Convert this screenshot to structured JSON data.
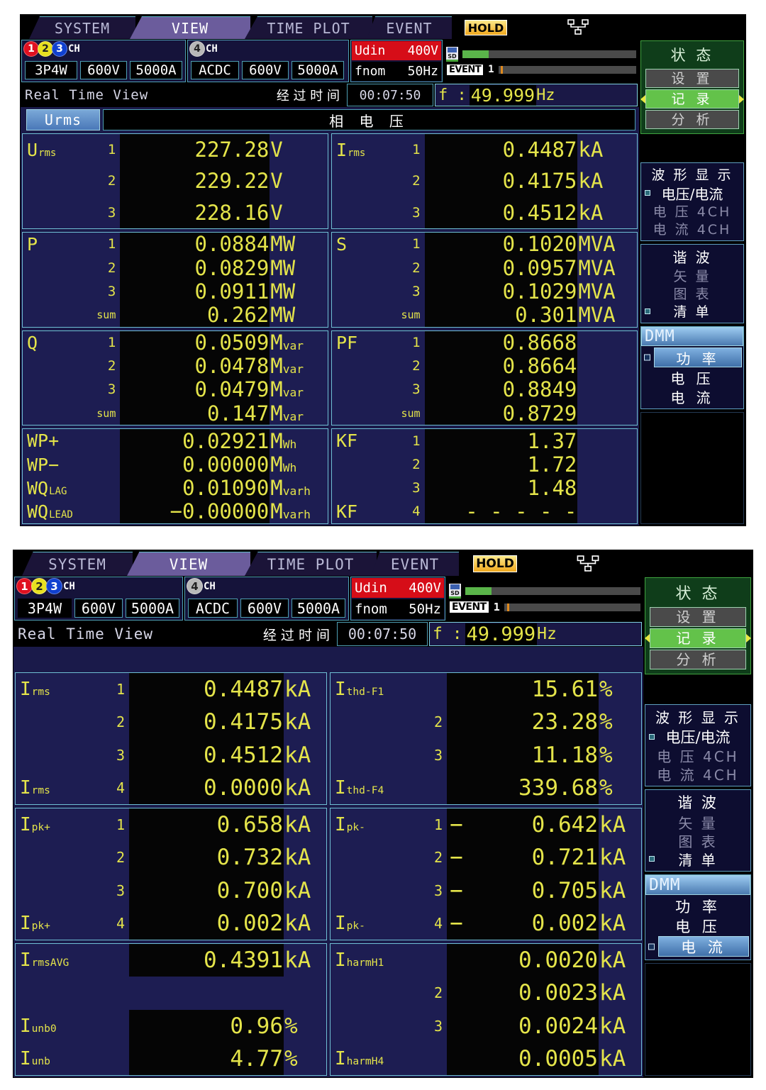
{
  "tabs": [
    {
      "label": "SYSTEM",
      "active": false
    },
    {
      "label": "VIEW",
      "active": true
    },
    {
      "label": "TIME PLOT",
      "active": false
    },
    {
      "label": "EVENT",
      "active": false
    }
  ],
  "hold_badge": "HOLD",
  "network_icon": "network-icon",
  "channel_group_1": {
    "numbers": [
      "1",
      "2",
      "3"
    ],
    "suffix": "CH",
    "fields": [
      "3P4W",
      "600V",
      "5000A"
    ]
  },
  "channel_group_4": {
    "numbers": [
      "4"
    ],
    "suffix": "CH",
    "fields": [
      "ACDC",
      "600V",
      "5000A"
    ]
  },
  "udin": {
    "label": "Udin",
    "value": "400V"
  },
  "fnom": {
    "label": "fnom",
    "value": "50Hz"
  },
  "sd": {
    "icon_label": "SD",
    "fill_percent": 15
  },
  "event": {
    "badge": "EVENT",
    "count": "1",
    "mark_percent": 2
  },
  "status": {
    "realtime_label": "Real Time View",
    "elapsed_label": "经 过 时 间",
    "elapsed_value": "00:07:50",
    "freq_label": "f :",
    "freq_value": "49.999",
    "freq_unit": "Hz"
  },
  "panel_top": {
    "subtab": "Urms",
    "subtitle": "相 电 压",
    "blocks_left": [
      {
        "name": "urms-block",
        "rows": [
          {
            "label": "U",
            "label_sub": "rms",
            "index": "1",
            "value": "227.28",
            "unit": "V",
            "unit_sub": ""
          },
          {
            "label": "",
            "label_sub": "",
            "index": "2",
            "value": "229.22",
            "unit": "V",
            "unit_sub": ""
          },
          {
            "label": "",
            "label_sub": "",
            "index": "3",
            "value": "228.16",
            "unit": "V",
            "unit_sub": ""
          }
        ]
      },
      {
        "name": "active-power-block",
        "rows": [
          {
            "label": "P",
            "label_sub": "",
            "index": "1",
            "value": "0.0884",
            "unit": "MW",
            "unit_sub": ""
          },
          {
            "label": "",
            "label_sub": "",
            "index": "2",
            "value": "0.0829",
            "unit": "MW",
            "unit_sub": ""
          },
          {
            "label": "",
            "label_sub": "",
            "index": "3",
            "value": "0.0911",
            "unit": "MW",
            "unit_sub": ""
          },
          {
            "label": "",
            "label_sub": "",
            "index": "sum",
            "value": "0.262",
            "unit": "MW",
            "unit_sub": ""
          }
        ]
      },
      {
        "name": "reactive-power-block",
        "rows": [
          {
            "label": "Q",
            "label_sub": "",
            "index": "1",
            "value": "0.0509",
            "unit": "M",
            "unit_sub": "var"
          },
          {
            "label": "",
            "label_sub": "",
            "index": "2",
            "value": "0.0478",
            "unit": "M",
            "unit_sub": "var"
          },
          {
            "label": "",
            "label_sub": "",
            "index": "3",
            "value": "0.0479",
            "unit": "M",
            "unit_sub": "var"
          },
          {
            "label": "",
            "label_sub": "",
            "index": "sum",
            "value": "0.147",
            "unit": "M",
            "unit_sub": "var"
          }
        ]
      },
      {
        "name": "energy-block",
        "rows": [
          {
            "label": "WP+",
            "label_sub": "",
            "index": "",
            "value": "0.02921",
            "unit": "M",
            "unit_sub": "Wh"
          },
          {
            "label": "WP−",
            "label_sub": "",
            "index": "",
            "value": "0.00000",
            "unit": "M",
            "unit_sub": "Wh"
          },
          {
            "label": "WQ",
            "label_sub": "LAG",
            "index": "",
            "value": "0.01090",
            "unit": "M",
            "unit_sub": "varh"
          },
          {
            "label": "WQ",
            "label_sub": "LEAD",
            "index": "",
            "value": "−0.00000",
            "unit": "M",
            "unit_sub": "varh"
          }
        ]
      }
    ],
    "blocks_right": [
      {
        "name": "irms-block",
        "rows": [
          {
            "label": "I",
            "label_sub": "rms",
            "index": "1",
            "value": "0.4487",
            "unit": "kA",
            "unit_sub": ""
          },
          {
            "label": "",
            "label_sub": "",
            "index": "2",
            "value": "0.4175",
            "unit": "kA",
            "unit_sub": ""
          },
          {
            "label": "",
            "label_sub": "",
            "index": "3",
            "value": "0.4512",
            "unit": "kA",
            "unit_sub": ""
          }
        ]
      },
      {
        "name": "apparent-power-block",
        "rows": [
          {
            "label": "S",
            "label_sub": "",
            "index": "1",
            "value": "0.1020",
            "unit": "MVA",
            "unit_sub": ""
          },
          {
            "label": "",
            "label_sub": "",
            "index": "2",
            "value": "0.0957",
            "unit": "MVA",
            "unit_sub": ""
          },
          {
            "label": "",
            "label_sub": "",
            "index": "3",
            "value": "0.1029",
            "unit": "MVA",
            "unit_sub": ""
          },
          {
            "label": "",
            "label_sub": "",
            "index": "sum",
            "value": "0.301",
            "unit": "MVA",
            "unit_sub": ""
          }
        ]
      },
      {
        "name": "power-factor-block",
        "rows": [
          {
            "label": "PF",
            "label_sub": "",
            "index": "1",
            "value": "0.8668",
            "unit": "",
            "unit_sub": ""
          },
          {
            "label": "",
            "label_sub": "",
            "index": "2",
            "value": "0.8664",
            "unit": "",
            "unit_sub": ""
          },
          {
            "label": "",
            "label_sub": "",
            "index": "3",
            "value": "0.8849",
            "unit": "",
            "unit_sub": ""
          },
          {
            "label": "",
            "label_sub": "",
            "index": "sum",
            "value": "0.8729",
            "unit": "",
            "unit_sub": ""
          }
        ]
      },
      {
        "name": "k-factor-block",
        "rows": [
          {
            "label": "KF",
            "label_sub": "",
            "index": "1",
            "value": "1.37",
            "unit": "",
            "unit_sub": ""
          },
          {
            "label": "",
            "label_sub": "",
            "index": "2",
            "value": "1.72",
            "unit": "",
            "unit_sub": ""
          },
          {
            "label": "",
            "label_sub": "",
            "index": "3",
            "value": "1.48",
            "unit": "",
            "unit_sub": ""
          },
          {
            "label": "KF",
            "label_sub": "",
            "index": "4",
            "value": "- - - - -",
            "unit": "",
            "unit_sub": ""
          }
        ]
      }
    ]
  },
  "panel_bottom": {
    "blocks_left": [
      {
        "name": "irms-block",
        "rows": [
          {
            "label": "I",
            "label_sub": "rms",
            "index": "1",
            "value": "0.4487",
            "unit": "kA",
            "unit_sub": ""
          },
          {
            "label": "",
            "label_sub": "",
            "index": "2",
            "value": "0.4175",
            "unit": "kA",
            "unit_sub": ""
          },
          {
            "label": "",
            "label_sub": "",
            "index": "3",
            "value": "0.4512",
            "unit": "kA",
            "unit_sub": ""
          },
          {
            "label": "I",
            "label_sub": "rms",
            "index": "4",
            "value": "0.0000",
            "unit": "kA",
            "unit_sub": ""
          }
        ]
      },
      {
        "name": "ipk-plus-block",
        "rows": [
          {
            "label": "I",
            "label_sub": "pk+",
            "index": "1",
            "value": "0.658",
            "unit": "kA",
            "unit_sub": ""
          },
          {
            "label": "",
            "label_sub": "",
            "index": "2",
            "value": "0.732",
            "unit": "kA",
            "unit_sub": ""
          },
          {
            "label": "",
            "label_sub": "",
            "index": "3",
            "value": "0.700",
            "unit": "kA",
            "unit_sub": ""
          },
          {
            "label": "I",
            "label_sub": "pk+",
            "index": "4",
            "value": "0.002",
            "unit": "kA",
            "unit_sub": ""
          }
        ]
      },
      {
        "name": "irms-avg-unbalance-block",
        "rows": [
          {
            "label": "I",
            "label_sub": "rmsAVG",
            "index": "",
            "value": "0.4391",
            "unit": "kA",
            "unit_sub": "",
            "align": "left"
          },
          {
            "label": "",
            "label_sub": "",
            "index": "",
            "value": "",
            "unit": "",
            "unit_sub": "",
            "spacer": true
          },
          {
            "label": "I",
            "label_sub": "unb0",
            "index": "",
            "value": "0.96",
            "unit": "%",
            "unit_sub": ""
          },
          {
            "label": "I",
            "label_sub": "unb",
            "index": "",
            "value": "4.77",
            "unit": "%",
            "unit_sub": ""
          }
        ]
      }
    ],
    "blocks_right": [
      {
        "name": "ithd-f-block",
        "rows": [
          {
            "label": "I",
            "label_sub": "thd-F1",
            "index": "",
            "value": "15.61",
            "unit": "%",
            "unit_sub": ""
          },
          {
            "label": "",
            "label_sub": "",
            "index": "2",
            "value": "23.28",
            "unit": "%",
            "unit_sub": ""
          },
          {
            "label": "",
            "label_sub": "",
            "index": "3",
            "value": "11.18",
            "unit": "%",
            "unit_sub": ""
          },
          {
            "label": "I",
            "label_sub": "thd-F4",
            "index": "",
            "value": "339.68",
            "unit": "%",
            "unit_sub": ""
          }
        ]
      },
      {
        "name": "ipk-minus-block",
        "rows": [
          {
            "label": "I",
            "label_sub": "pk-",
            "index": "1",
            "value": "0.642",
            "unit": "kA",
            "unit_sub": "",
            "neg": "−"
          },
          {
            "label": "",
            "label_sub": "",
            "index": "2",
            "value": "0.721",
            "unit": "kA",
            "unit_sub": "",
            "neg": "−"
          },
          {
            "label": "",
            "label_sub": "",
            "index": "3",
            "value": "0.705",
            "unit": "kA",
            "unit_sub": "",
            "neg": "−"
          },
          {
            "label": "I",
            "label_sub": "pk-",
            "index": "4",
            "value": "0.002",
            "unit": "kA",
            "unit_sub": "",
            "neg": "−"
          }
        ]
      },
      {
        "name": "iharm-block",
        "rows": [
          {
            "label": "I",
            "label_sub": "harmH1",
            "index": "",
            "value": "0.0020",
            "unit": "kA",
            "unit_sub": ""
          },
          {
            "label": "",
            "label_sub": "",
            "index": "2",
            "value": "0.0023",
            "unit": "kA",
            "unit_sub": ""
          },
          {
            "label": "",
            "label_sub": "",
            "index": "3",
            "value": "0.0024",
            "unit": "kA",
            "unit_sub": ""
          },
          {
            "label": "I",
            "label_sub": "harmH4",
            "index": "",
            "value": "0.0005",
            "unit": "kA",
            "unit_sub": ""
          }
        ]
      }
    ]
  },
  "sidebar": {
    "status_group": {
      "title": "状 态",
      "items": [
        {
          "label": "设 置",
          "selected": false
        },
        {
          "label": "记 录",
          "selected": true
        },
        {
          "label": "分 析",
          "selected": false
        }
      ]
    },
    "waveform_group": {
      "title": "波 形 显 示",
      "items": [
        {
          "label": "电压/电流",
          "selected": true
        },
        {
          "label": "电 压 4CH",
          "selected": false
        },
        {
          "label": "电 流 4CH",
          "selected": false
        }
      ]
    },
    "harmonic_group": {
      "title": "谐 波",
      "items": [
        {
          "label": "矢 量",
          "selected": false
        },
        {
          "label": "图 表",
          "selected": false
        },
        {
          "label": "清 单",
          "selected": true
        }
      ]
    },
    "dmm_group_top": {
      "title": "DMM",
      "items": [
        {
          "label": "功 率",
          "selected": true
        },
        {
          "label": "电 压",
          "selected": false
        },
        {
          "label": "电 流",
          "selected": false
        }
      ]
    },
    "dmm_group_bottom": {
      "title": "DMM",
      "items": [
        {
          "label": "功 率",
          "selected": false
        },
        {
          "label": "电 压",
          "selected": false
        },
        {
          "label": "电 流",
          "selected": true
        }
      ]
    }
  },
  "colors": {
    "accent_yellow": "#e4e44a",
    "panel_blue": "#1a1a4a",
    "border_cyan": "#6fbfd4",
    "alarm_red": "#d60d18",
    "select_green": "#63c24a",
    "ch1": "#e01020",
    "ch2": "#e8e020",
    "ch3": "#1040d0",
    "ch4": "#b8b8b8"
  }
}
